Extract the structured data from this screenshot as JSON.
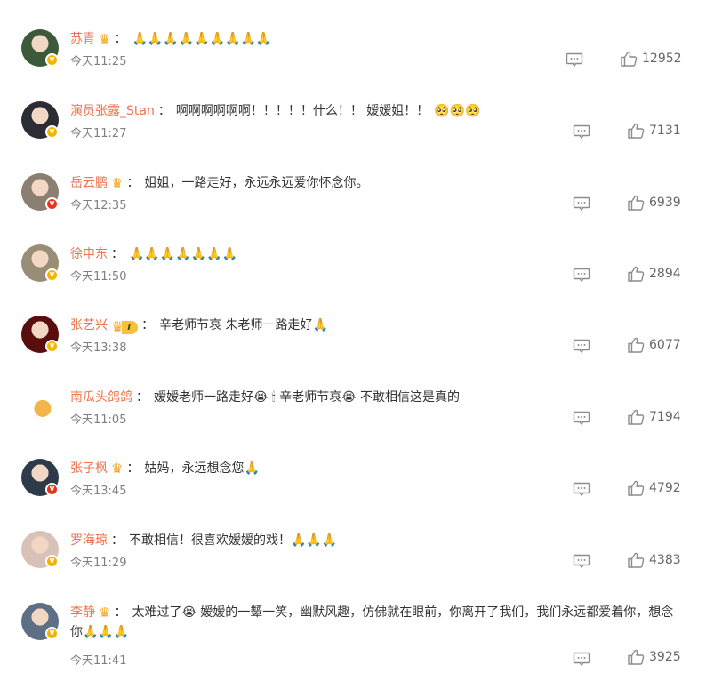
{
  "comments": [
    {
      "user": "苏青",
      "badge": "crown",
      "segments": [
        "🙏🙏🙏🙏🙏🙏🙏🙏🙏"
      ],
      "time": "今天11:25",
      "likes": "12952",
      "verify": "yellow",
      "avatar_color": "#3b5a3a"
    },
    {
      "user": "演员张露_Stan",
      "badge": "",
      "segments": [
        "啊啊啊啊啊啊！！！！！什么！！ 嫒嫒姐！！",
        "🥺🥺🥺"
      ],
      "time": "今天11:27",
      "likes": "7131",
      "verify": "yellow",
      "avatar_color": "#2c2c34"
    },
    {
      "user": "岳云鹏",
      "badge": "crown",
      "segments": [
        "姐姐，一路走好，永远永远爱你怀念你。"
      ],
      "time": "今天12:35",
      "likes": "6939",
      "verify": "red",
      "avatar_color": "#8a7f70"
    },
    {
      "user": "徐申东",
      "badge": "",
      "segments": [
        "🙏🙏🙏🙏🙏🙏🙏"
      ],
      "time": "今天11:50",
      "likes": "2894",
      "verify": "yellow",
      "avatar_color": "#9a8d78"
    },
    {
      "user": "张艺兴",
      "badge": "vip",
      "vip_level": "I",
      "segments": [
        "辛老师节哀 朱老师一路走好🙏"
      ],
      "time": "今天13:38",
      "likes": "6077",
      "verify": "yellow",
      "avatar_color": "#5a0d0d"
    },
    {
      "user": "南瓜头鸽鸽",
      "badge": "",
      "segments": [
        "嫒嫒老师一路走好😭 🕯 辛老师节哀😭 不敢相信这是真的"
      ],
      "time": "今天11:05",
      "likes": "7194",
      "verify": "",
      "avatar_color": "#d9a23a"
    },
    {
      "user": "张子枫",
      "badge": "crown",
      "segments": [
        "姑妈，永远想念您🙏"
      ],
      "time": "今天13:45",
      "likes": "4792",
      "verify": "red",
      "avatar_color": "#2c3a4a"
    },
    {
      "user": "罗海琼",
      "badge": "",
      "segments": [
        "不敢相信！很喜欢嫒嫒的戏！🙏🙏🙏"
      ],
      "time": "今天11:29",
      "likes": "4383",
      "verify": "yellow",
      "avatar_color": "#d8c2b8"
    },
    {
      "user": "李静",
      "badge": "crown",
      "segments": [
        "太难过了😭 嫒嫒的一颦一笑，幽默风趣，仿佛就在眼前，你离开了我们，我们永远都爱着你，想念你🙏🙏🙏"
      ],
      "time": "今天11:41",
      "likes": "3925",
      "verify": "yellow",
      "avatar_color": "#5c6f84"
    }
  ],
  "icons": {
    "reply": "comment-bubble-icon",
    "like": "thumbs-up-icon",
    "crown": "crown-icon",
    "verified": "verified-v-icon"
  },
  "colors": {
    "username": "#eb7350",
    "time": "#808080",
    "text": "#333333",
    "badge_yellow": "#f5b400",
    "badge_red": "#e8341f"
  }
}
